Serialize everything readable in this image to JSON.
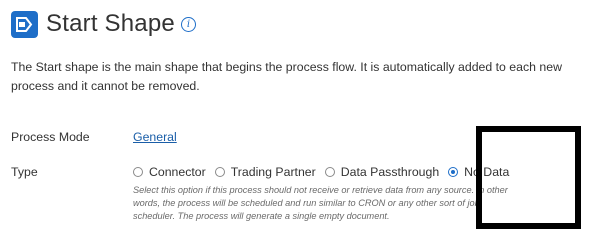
{
  "header": {
    "title": "Start Shape",
    "logo_icon": "process-shape-icon",
    "info_icon": "info-icon",
    "info_glyph": "i",
    "accent": "#1e6ec8"
  },
  "description": "The Start shape is the main shape that begins the process flow. It is automatically added to each new process and it cannot be removed.",
  "process_mode": {
    "label": "Process Mode",
    "value": "General"
  },
  "type": {
    "label": "Type",
    "options": [
      {
        "label": "Connector",
        "selected": false
      },
      {
        "label": "Trading Partner",
        "selected": false
      },
      {
        "label": "Data Passthrough",
        "selected": false
      },
      {
        "label": "No Data",
        "selected": true
      }
    ],
    "help_text": "Select this option if this process should not receive or retrieve data from any source. In other words, the process will be scheduled and run similar to CRON or any other sort of job scheduler. The process will generate a single empty document."
  },
  "annotation": {
    "highlight_color": "#000000"
  }
}
